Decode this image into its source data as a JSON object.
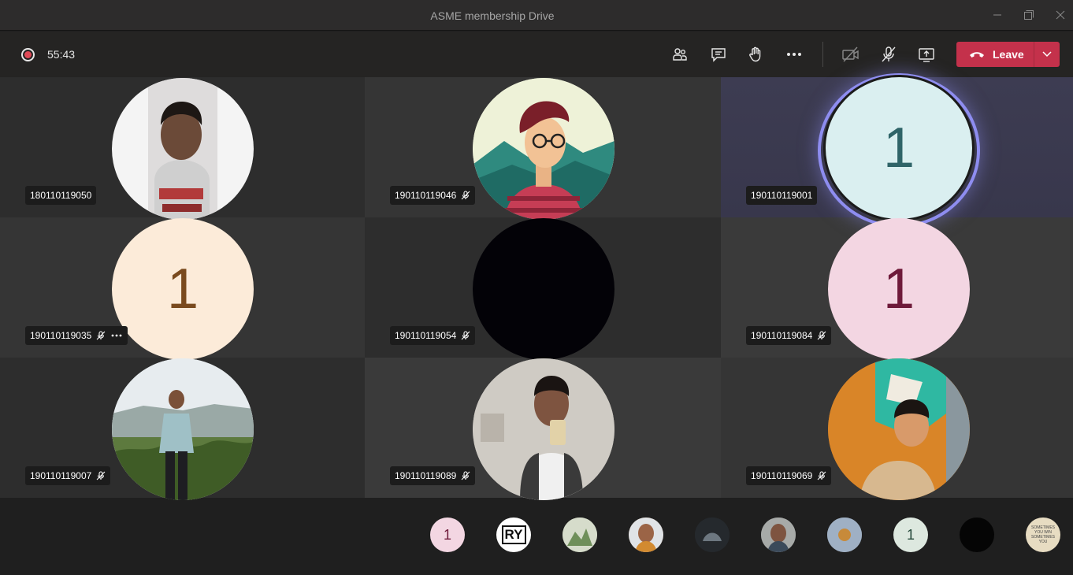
{
  "window": {
    "title": "ASME membership Drive"
  },
  "toolbar": {
    "timer": "55:43",
    "leave_label": "Leave",
    "leave_color": "#c4314b"
  },
  "tiles": [
    {
      "name": "180110119050",
      "muted": false,
      "more": false,
      "avatar": "photo"
    },
    {
      "name": "190110119046",
      "muted": true,
      "more": false,
      "avatar": "illustration"
    },
    {
      "name": "190110119001",
      "muted": false,
      "more": false,
      "avatar": "initial",
      "initial": "1",
      "speaking": true
    },
    {
      "name": "190110119035",
      "muted": true,
      "more": true,
      "avatar": "initial",
      "initial": "1"
    },
    {
      "name": "190110119054",
      "muted": true,
      "more": false,
      "avatar": "black"
    },
    {
      "name": "190110119084",
      "muted": true,
      "more": false,
      "avatar": "initial",
      "initial": "1"
    },
    {
      "name": "190110119007",
      "muted": true,
      "more": false,
      "avatar": "photo"
    },
    {
      "name": "190110119089",
      "muted": true,
      "more": false,
      "avatar": "photo"
    },
    {
      "name": "190110119069",
      "muted": true,
      "more": false,
      "avatar": "photo"
    }
  ],
  "strip": {
    "avatars": [
      {
        "kind": "initial",
        "text": "1",
        "color": "#f3d6e2"
      },
      {
        "kind": "logo",
        "text": "RY"
      },
      {
        "kind": "photo"
      },
      {
        "kind": "photo"
      },
      {
        "kind": "photo"
      },
      {
        "kind": "photo"
      },
      {
        "kind": "photo"
      },
      {
        "kind": "initial",
        "text": "1",
        "color": "#dde8df"
      },
      {
        "kind": "black"
      },
      {
        "kind": "text-image",
        "text": "SOMETIMES YOU WIN SOMETIMES YOU"
      }
    ]
  }
}
